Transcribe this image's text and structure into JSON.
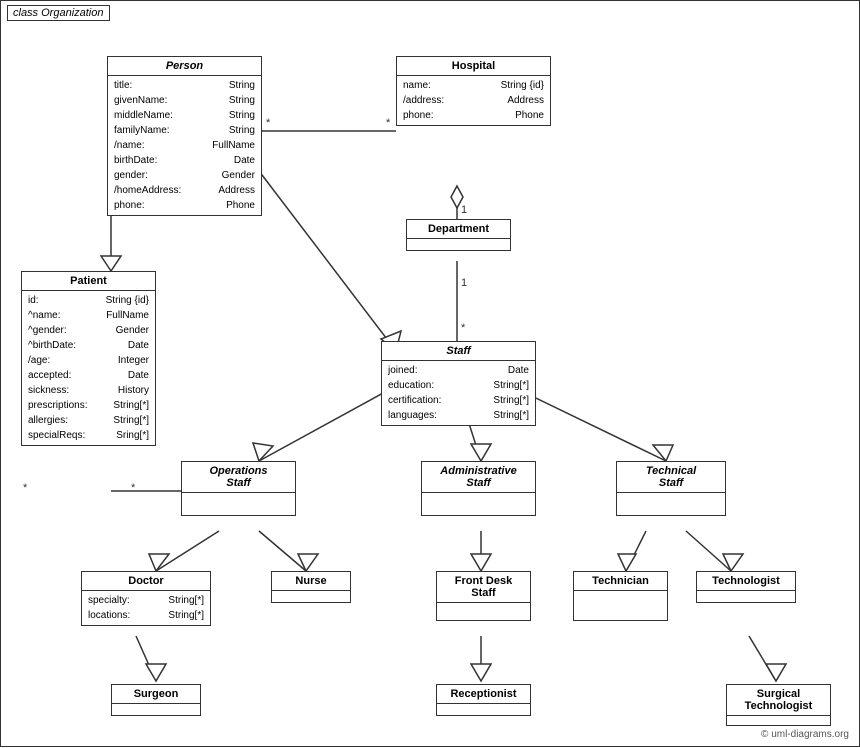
{
  "diagram": {
    "corner_label": "class Organization",
    "copyright": "© uml-diagrams.org",
    "classes": {
      "person": {
        "title": "Person",
        "italic": true,
        "attrs": [
          [
            "title:",
            "String"
          ],
          [
            "givenName:",
            "String"
          ],
          [
            "middleName:",
            "String"
          ],
          [
            "familyName:",
            "String"
          ],
          [
            "/name:",
            "FullName"
          ],
          [
            "birthDate:",
            "Date"
          ],
          [
            "gender:",
            "Gender"
          ],
          [
            "/homeAddress:",
            "Address"
          ],
          [
            "phone:",
            "Phone"
          ]
        ]
      },
      "hospital": {
        "title": "Hospital",
        "italic": false,
        "attrs": [
          [
            "name:",
            "String {id}"
          ],
          [
            "/address:",
            "Address"
          ],
          [
            "phone:",
            "Phone"
          ]
        ]
      },
      "department": {
        "title": "Department",
        "italic": false,
        "attrs": []
      },
      "staff": {
        "title": "Staff",
        "italic": true,
        "attrs": [
          [
            "joined:",
            "Date"
          ],
          [
            "education:",
            "String[*]"
          ],
          [
            "certification:",
            "String[*]"
          ],
          [
            "languages:",
            "String[*]"
          ]
        ]
      },
      "patient": {
        "title": "Patient",
        "italic": false,
        "attrs": [
          [
            "id:",
            "String {id}"
          ],
          [
            "^name:",
            "FullName"
          ],
          [
            "^gender:",
            "Gender"
          ],
          [
            "^birthDate:",
            "Date"
          ],
          [
            "/age:",
            "Integer"
          ],
          [
            "accepted:",
            "Date"
          ],
          [
            "sickness:",
            "History"
          ],
          [
            "prescriptions:",
            "String[*]"
          ],
          [
            "allergies:",
            "String[*]"
          ],
          [
            "specialReqs:",
            "Sring[*]"
          ]
        ]
      },
      "operations_staff": {
        "title": "Operations Staff",
        "italic": true,
        "attrs": []
      },
      "administrative_staff": {
        "title": "Administrative Staff",
        "italic": true,
        "attrs": []
      },
      "technical_staff": {
        "title": "Technical Staff",
        "italic": true,
        "attrs": []
      },
      "doctor": {
        "title": "Doctor",
        "italic": false,
        "attrs": [
          [
            "specialty:",
            "String[*]"
          ],
          [
            "locations:",
            "String[*]"
          ]
        ]
      },
      "nurse": {
        "title": "Nurse",
        "italic": false,
        "attrs": []
      },
      "front_desk_staff": {
        "title": "Front Desk Staff",
        "italic": false,
        "attrs": []
      },
      "technician": {
        "title": "Technician",
        "italic": false,
        "attrs": []
      },
      "technologist": {
        "title": "Technologist",
        "italic": false,
        "attrs": []
      },
      "surgeon": {
        "title": "Surgeon",
        "italic": false,
        "attrs": []
      },
      "receptionist": {
        "title": "Receptionist",
        "italic": false,
        "attrs": []
      },
      "surgical_technologist": {
        "title": "Surgical Technologist",
        "italic": false,
        "attrs": []
      }
    }
  }
}
